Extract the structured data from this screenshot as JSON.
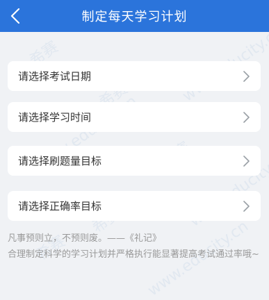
{
  "header": {
    "title": "制定每天学习计划",
    "back_icon": "chevron-left-icon"
  },
  "options": [
    {
      "label": "请选择考试日期"
    },
    {
      "label": "请选择学习时间"
    },
    {
      "label": "请选择刷题量目标"
    },
    {
      "label": "请选择正确率目标"
    }
  ],
  "quote": {
    "line1": "凡事预则立，不预则废。——《礼记》",
    "line2": "合理制定科学的学习计划并严格执行能显著提高考试通过率哦~"
  },
  "watermark": {
    "brand": "希赛",
    "url": "www.educity.cn"
  },
  "colors": {
    "header_bg": "#2b74db",
    "page_bg": "#f0f2f5",
    "quote_text": "#999999"
  }
}
